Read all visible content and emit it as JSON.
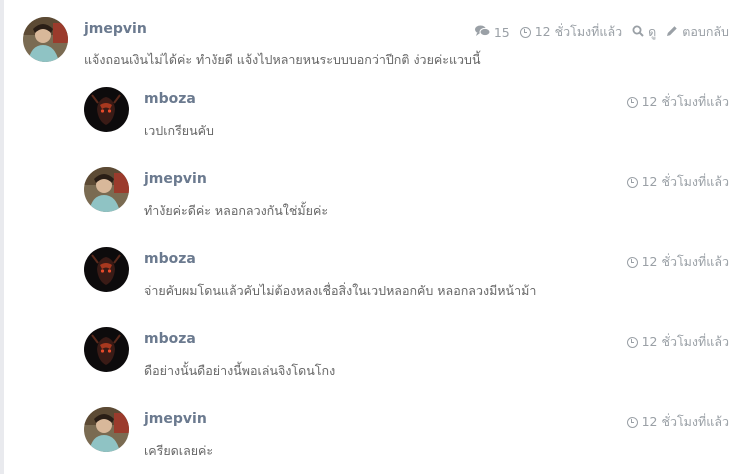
{
  "main_post": {
    "username": "jmepvin",
    "text": "แจ้งถอนเงินไม่ได้ค่ะ ทำงัยดี แจ้งไปหลายหนระบบบอกว่าปีกติ ง่วยค่ะแวบนี้",
    "reply_count": "15",
    "time": "12 ชั่วโมงที่แล้ว",
    "view_label": "ดู",
    "reply_label": "ตอบกลับ"
  },
  "replies": [
    {
      "username": "mboza",
      "text": "เวปเกรียนคับ",
      "time": "12 ชั่วโมงที่แล้ว",
      "avatar": "dark"
    },
    {
      "username": "jmepvin",
      "text": "ทำงัยค่ะดีค่ะ หลอกลวงกันใช่มั้ยค่ะ",
      "time": "12 ชั่วโมงที่แล้ว",
      "avatar": "light"
    },
    {
      "username": "mboza",
      "text": "จ่ายคับผมโดนแล้วคับไม่ต้องหลงเชื่อสิ่งในเวปหลอกคับ หลอกลวงมีหน้าม้า",
      "time": "12 ชั่วโมงที่แล้ว",
      "avatar": "dark"
    },
    {
      "username": "mboza",
      "text": "ดือย่างนั้นดือย่างนี้พอเล่นจิงโดนโกง",
      "time": "12 ชั่วโมงที่แล้ว",
      "avatar": "dark"
    },
    {
      "username": "jmepvin",
      "text": "เครียดเลยค่ะ",
      "time": "12 ชั่วโมงที่แล้ว",
      "avatar": "light"
    }
  ],
  "colors": {
    "username": "#6b7a8f",
    "meta": "#9aa0a6",
    "text": "#666666"
  }
}
